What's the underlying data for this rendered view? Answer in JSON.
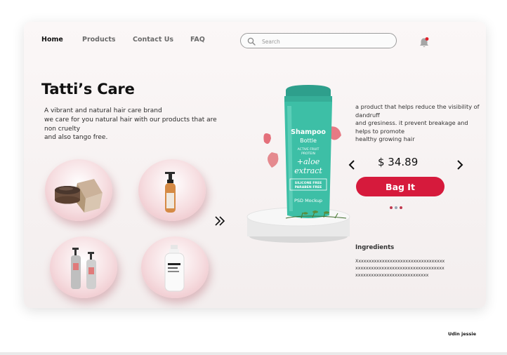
{
  "nav": {
    "items": [
      "Home",
      "Products",
      "Contact Us",
      "FAQ"
    ],
    "active": "Home"
  },
  "search": {
    "placeholder": "Search"
  },
  "brand": {
    "title": "Tatti’s Care",
    "description": [
      "A vibrant and natural hair care brand",
      "we care for you natural hair with our products that are",
      "non cruelty",
      "and also tango free."
    ]
  },
  "products": [
    {
      "icon": "cosmetic-jar-box-icon"
    },
    {
      "icon": "amber-pump-bottle-icon"
    },
    {
      "icon": "twin-pump-bottles-icon"
    },
    {
      "icon": "white-lotion-bottle-icon"
    }
  ],
  "featured": {
    "bottle": {
      "brand_line1": "Shampoo",
      "brand_line2": "Bottle",
      "sub_line1": "ACTIVE FRUIT",
      "sub_line2": "PROTEIN",
      "plus_line1": "+aloe",
      "plus_line2": "extract",
      "badge_line1": "SILICONE FREE",
      "badge_line2": "PARABEN FREE",
      "footer": "PSD Mockup"
    },
    "description": [
      "a product that helps reduce the visibility of dandruff",
      "and gresiness. it prevent breakage and helps to promote",
      "healthy growing hair"
    ],
    "price": "$ 34.89",
    "cta": "Bag It",
    "carousel_dots": 3,
    "ingredients_title": "Ingredients",
    "ingredients_text": "Xxxxxxxxxxxxxxxxxxxxxxxxxxxxxxxxxxxxxxxxxxxxxxxxxxxxxxxxxxxxxxxxxxxxxxxxxxxxxxxxxxxxxxxxxxxxxxxx"
  },
  "footer": {
    "author": "Udin jessie"
  },
  "colors": {
    "accent": "#d61a3c",
    "bottle": "#3dbfa6",
    "dot_active": "#c0394f",
    "dot_inactive": "#9aa7b5",
    "bell_badge": "#e0202a"
  }
}
